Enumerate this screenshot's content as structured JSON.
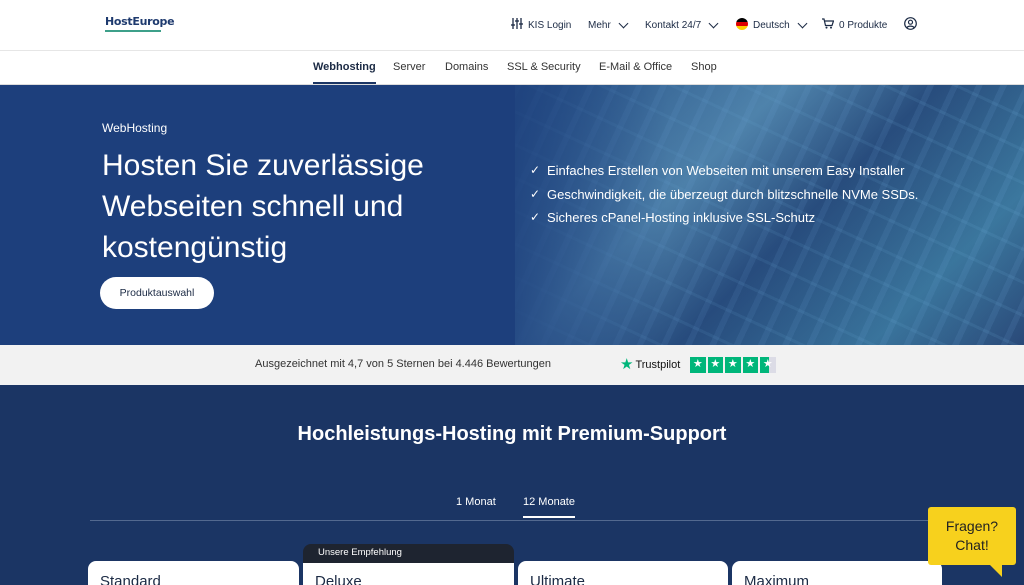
{
  "header": {
    "logo": "HostEurope",
    "kis_login": "KIS Login",
    "mehr": "Mehr",
    "kontakt": "Kontakt 24/7",
    "language": "Deutsch",
    "cart": "0 Produkte"
  },
  "nav": {
    "tabs": [
      "Webhosting",
      "Server",
      "Domains",
      "SSL & Security",
      "E-Mail & Office",
      "Shop"
    ]
  },
  "hero": {
    "eyebrow": "WebHosting",
    "title": "Hosten Sie zuverlässige Webseiten schnell und kostengünstig",
    "button": "Produktauswahl",
    "features": [
      "Einfaches Erstellen von Webseiten mit unserem Easy Installer",
      "Geschwindigkeit, die überzeugt durch blitzschnelle NVMe SSDs.",
      "Sicheres cPanel-Hosting inklusive SSL-Schutz"
    ]
  },
  "trust": {
    "text": "Ausgezeichnet mit 4,7 von 5 Sternen bei 4.446 Bewertungen",
    "brand": "Trustpilot",
    "rating": 4.7
  },
  "plans": {
    "title": "Hochleistungs-Hosting mit Premium-Support",
    "periods": [
      "1 Monat",
      "12 Monate"
    ],
    "recommended": "Unsere Empfehlung",
    "names": [
      "Standard",
      "Deluxe",
      "Ultimate",
      "Maximum"
    ]
  },
  "chat": {
    "line1": "Fragen?",
    "line2": "Chat!"
  },
  "colors": {
    "hero_bg": "#1d3f7c",
    "section_bg": "#1b3564",
    "trustpilot_green": "#00b67a",
    "chat_yellow": "#f7d11d"
  }
}
